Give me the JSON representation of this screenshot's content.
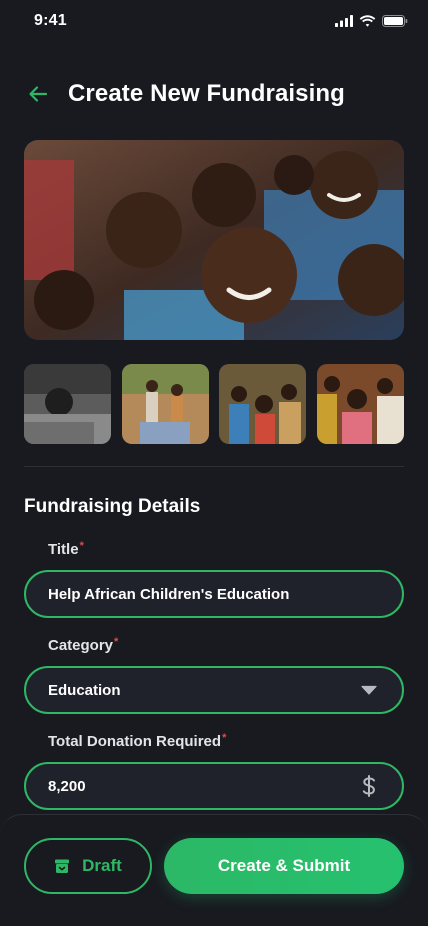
{
  "status_bar": {
    "time": "9:41"
  },
  "header": {
    "title": "Create New Fundraising"
  },
  "images": {
    "hero_icon": "photo-children-smiling",
    "thumbnails": [
      "photo-child-at-desk",
      "photo-children-standing",
      "photo-children-group",
      "photo-girls-crowd"
    ]
  },
  "section": {
    "title": "Fundraising Details"
  },
  "form": {
    "title": {
      "label": "Title",
      "required_mark": "*",
      "value": "Help African Children's Education"
    },
    "category": {
      "label": "Category",
      "required_mark": "*",
      "value": "Education"
    },
    "donation": {
      "label": "Total Donation Required",
      "required_mark": "*",
      "value": "8,200"
    }
  },
  "actions": {
    "draft_label": "Draft",
    "submit_label": "Create & Submit"
  },
  "colors": {
    "accent": "#2fb765",
    "background": "#181a20",
    "field_bg": "#1f222a",
    "required": "#e5484d"
  }
}
